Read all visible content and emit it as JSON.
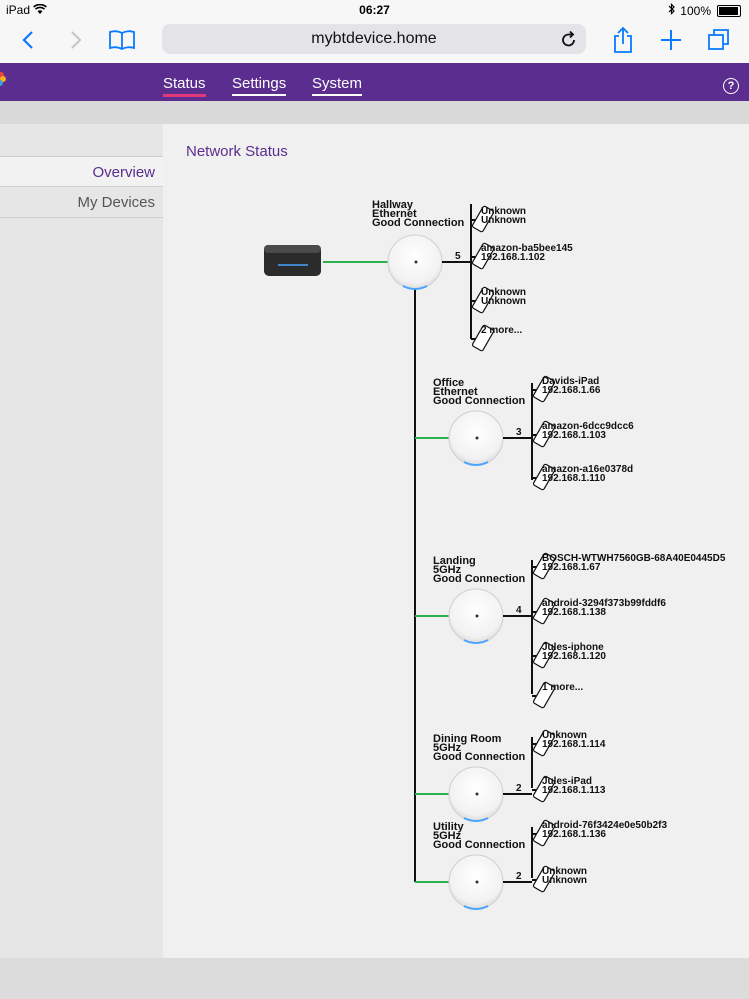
{
  "statusbar": {
    "device": "iPad",
    "time": "06:27",
    "battery": "100%"
  },
  "browser": {
    "url": "mybtdevice.home"
  },
  "nav": {
    "tabs": [
      "Status",
      "Settings",
      "System"
    ],
    "help": "?"
  },
  "sidebar": {
    "items": [
      "Overview",
      "My Devices"
    ]
  },
  "page": {
    "title": "Network Status"
  },
  "network": {
    "discs": [
      {
        "name": "Hallway",
        "conn": "Ethernet",
        "status": "Good Connection",
        "count": "5",
        "devices": [
          {
            "l1": "Unknown",
            "l2": "Unknown"
          },
          {
            "l1": "amazon-ba5bee145",
            "l2": "192.168.1.102"
          },
          {
            "l1": "Unknown",
            "l2": "Unknown"
          },
          {
            "l1": "2 more...",
            "l2": ""
          }
        ]
      },
      {
        "name": "Office",
        "conn": "Ethernet",
        "status": "Good Connection",
        "count": "3",
        "devices": [
          {
            "l1": "Davids-iPad",
            "l2": "192.168.1.66"
          },
          {
            "l1": "amazon-6dcc9dcc6",
            "l2": "192.168.1.103"
          },
          {
            "l1": "amazon-a16e0378d",
            "l2": "192.168.1.110"
          }
        ]
      },
      {
        "name": "Landing",
        "conn": "5GHz",
        "status": "Good Connection",
        "count": "4",
        "devices": [
          {
            "l1": "BOSCH-WTWH7560GB-68A40E0445D5",
            "l2": "192.168.1.67"
          },
          {
            "l1": "android-3294f373b99fddf6",
            "l2": "192.168.1.138"
          },
          {
            "l1": "Jules-iphone",
            "l2": "192.168.1.120"
          },
          {
            "l1": "1 more...",
            "l2": ""
          }
        ]
      },
      {
        "name": "Dining Room",
        "conn": "5GHz",
        "status": "Good Connection",
        "count": "2",
        "devices": [
          {
            "l1": "Unknown",
            "l2": "192.168.1.114"
          },
          {
            "l1": "Jules-iPad",
            "l2": "192.168.1.113"
          }
        ]
      },
      {
        "name": "Utility",
        "conn": "5GHz",
        "status": "Good Connection",
        "count": "2",
        "devices": [
          {
            "l1": "android-76f3424e0e50b2f3",
            "l2": "192.168.1.136"
          },
          {
            "l1": "Unknown",
            "l2": "Unknown"
          }
        ]
      }
    ]
  }
}
